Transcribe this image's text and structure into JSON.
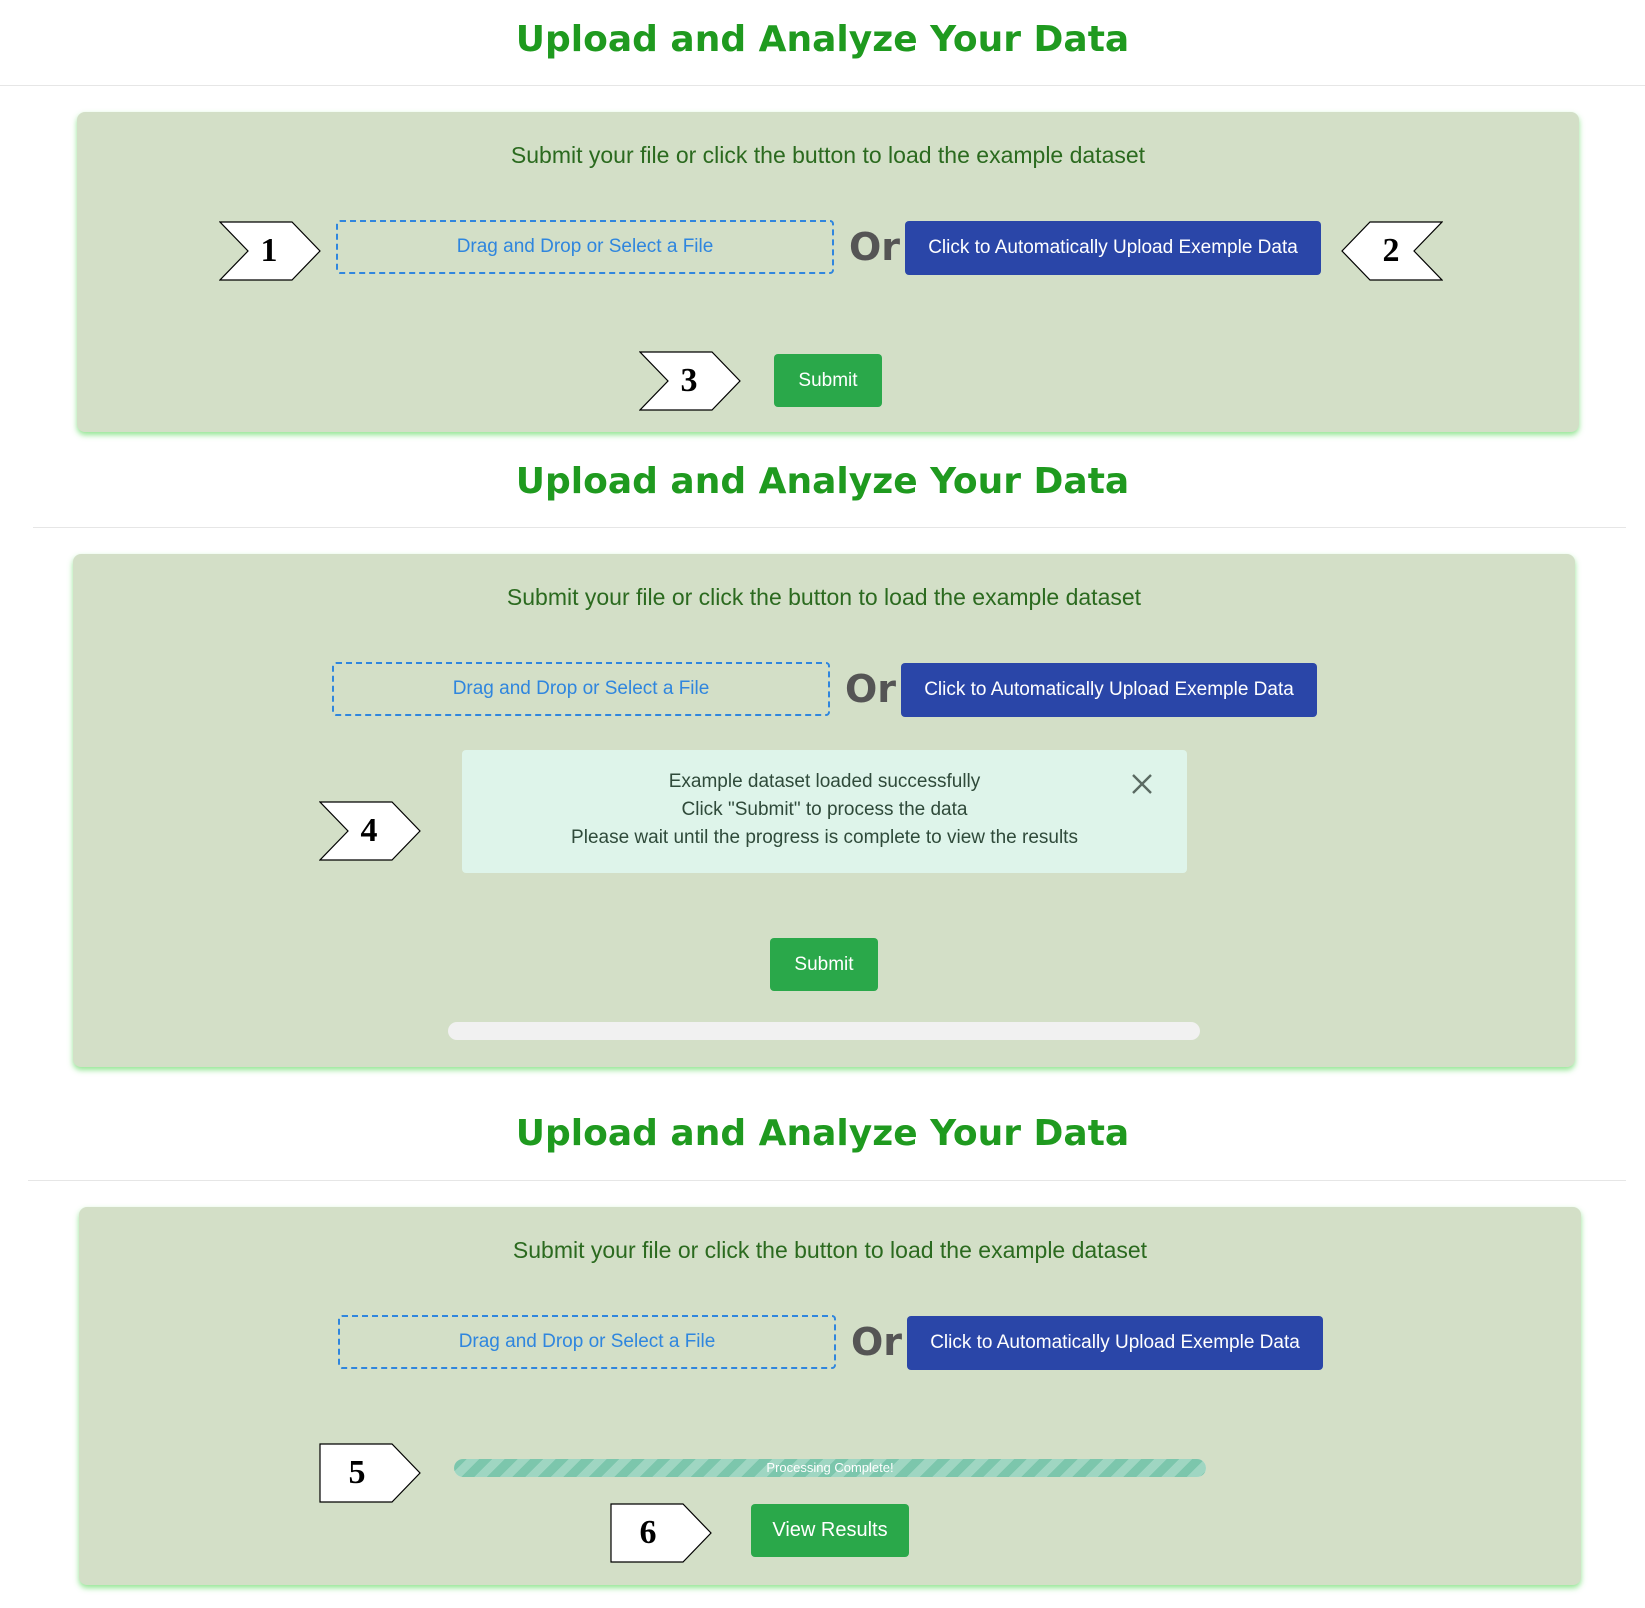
{
  "page_title": "Upload and Analyze Your Data",
  "instruction": "Submit your file or click the button to load the example dataset",
  "dropzone_label": "Drag and Drop or Select a File",
  "or_label": "Or",
  "example_button_label": "Click to Automatically Upload Exemple Data",
  "submit_label": "Submit",
  "alert": {
    "lines": [
      "Example dataset loaded successfully",
      "Click \"Submit\" to process the data",
      "Please wait until the progress is complete to view the results"
    ],
    "close_icon": "close-icon"
  },
  "progress": {
    "panel2_value": 0,
    "panel3_value": 100,
    "panel3_label": "Processing Complete!"
  },
  "view_results_label": "View Results",
  "callouts": [
    "1",
    "2",
    "3",
    "4",
    "5",
    "6"
  ],
  "colors": {
    "title": "#1f9a1f",
    "card_bg": "#d3dfc7",
    "primary_blue": "#2a46a8",
    "success_green": "#2aa84a",
    "dropzone_border": "#2f86de",
    "alert_bg": "#def4ea",
    "progress_stripe": "#7cc6ac"
  }
}
